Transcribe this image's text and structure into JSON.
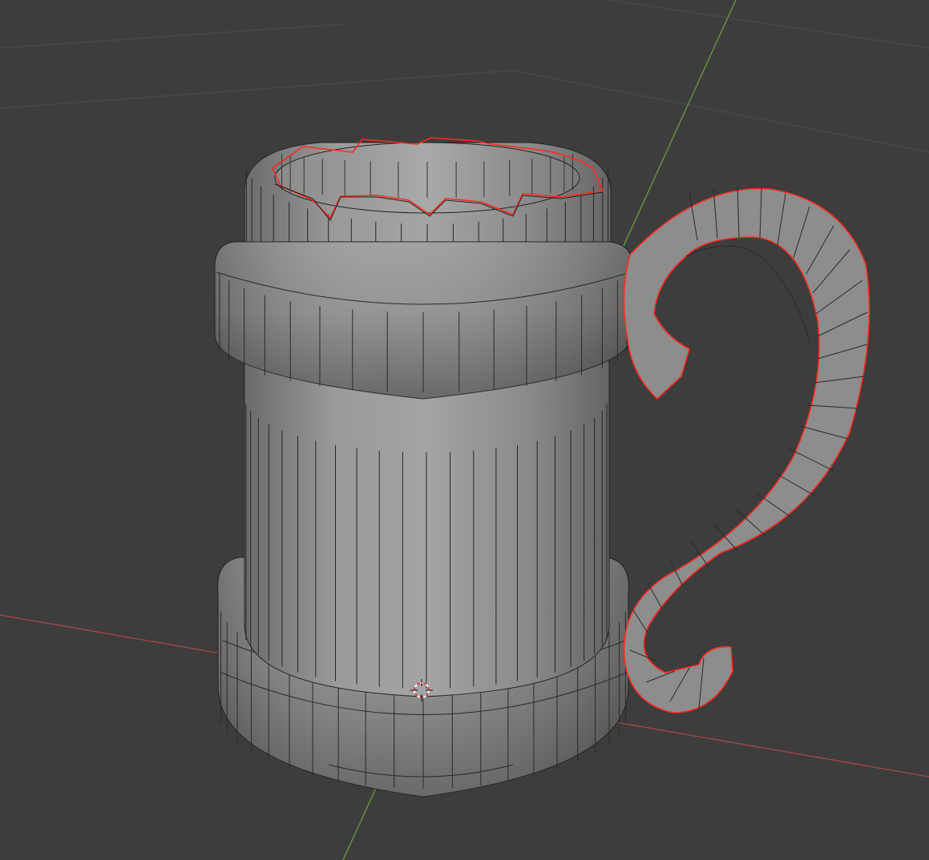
{
  "viewport": {
    "mode": "edit-mode",
    "background_color": "#3d3d3d",
    "grid_color": "#4a4a4a",
    "x_axis_color": "#a8474f",
    "y_axis_color": "#6d9a3c"
  },
  "mesh": {
    "object": "tankard",
    "parts": [
      "mug-top-section",
      "upper-band-ring",
      "mug-body",
      "lower-base-ring",
      "mug-handle"
    ],
    "face_color": "#8c8c8c",
    "edge_color": "#1e1e1e",
    "seam_color": "#ff2a1e"
  },
  "cursor": {
    "icon": "3d-cursor-icon",
    "primary_color": "#e03a3a",
    "secondary_color": "#ffffff"
  }
}
